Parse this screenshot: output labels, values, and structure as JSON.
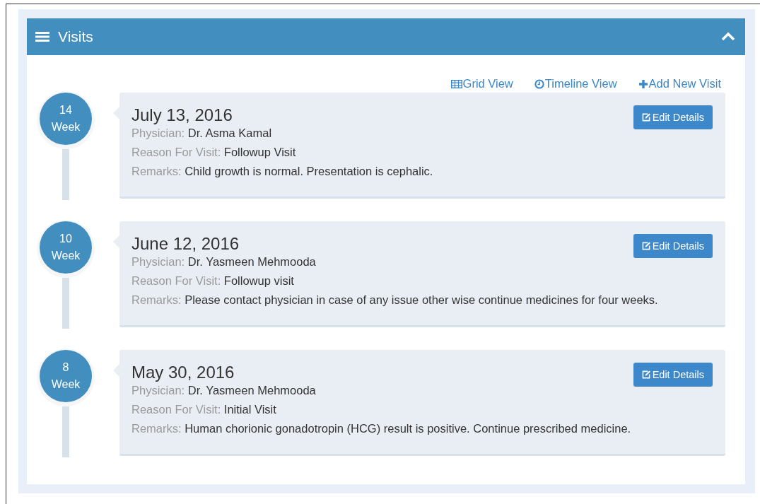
{
  "panel": {
    "title": "Visits",
    "expanded": true
  },
  "links": [
    {
      "kind": "grid",
      "label": "Grid View"
    },
    {
      "kind": "clock",
      "label": "Timeline View"
    },
    {
      "kind": "plus",
      "label": "Add New Visit"
    }
  ],
  "visits": [
    {
      "week": "14",
      "unit": "Week",
      "date": "July 13, 2016",
      "fields": [
        {
          "label": "Physician:",
          "value": "Dr. Asma Kamal"
        },
        {
          "label": "Reason For Visit:",
          "value": "Followup Visit"
        },
        {
          "label": "Remarks:",
          "value": "Child growth is normal. Presentation is cephalic."
        }
      ],
      "button": "Edit Details"
    },
    {
      "week": "10",
      "unit": "Week",
      "date": "June 12, 2016",
      "fields": [
        {
          "label": "Physician:",
          "value": "Dr. Yasmeen Mehmooda"
        },
        {
          "label": "Reason For Visit:",
          "value": "Followup visit"
        },
        {
          "label": "Remarks:",
          "value": "Please contact physician in case of any issue other wise continue medicines for four weeks."
        }
      ],
      "button": "Edit Details"
    },
    {
      "week": "8",
      "unit": "Week",
      "date": "May 30, 2016",
      "fields": [
        {
          "label": "Physician:",
          "value": "Dr. Yasmeen Mehmooda"
        },
        {
          "label": "Reason For Visit:",
          "value": "Initial Visit"
        },
        {
          "label": "Remarks:",
          "value": "Human chorionic gonadotropin (HCG) result is positive. Continue prescribed medicine."
        }
      ],
      "button": "Edit Details"
    }
  ]
}
